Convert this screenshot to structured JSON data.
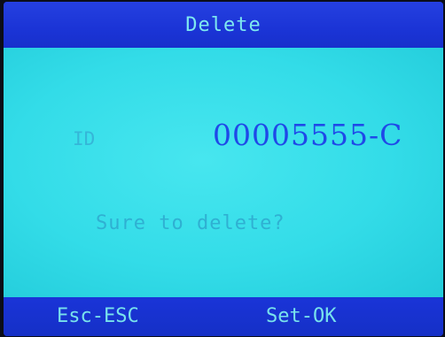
{
  "screen": {
    "title": "Delete",
    "id_label": "ID",
    "id_value": "00005555-C",
    "prompt": "Sure to delete?",
    "softkeys": {
      "left": "Esc-ESC",
      "right": "Set-OK"
    }
  },
  "colors": {
    "frame_blue": "#1a2fd8",
    "content_cyan": "#33dce8",
    "id_value_blue": "#1f49e8",
    "faint_text": "#35b6d8"
  }
}
